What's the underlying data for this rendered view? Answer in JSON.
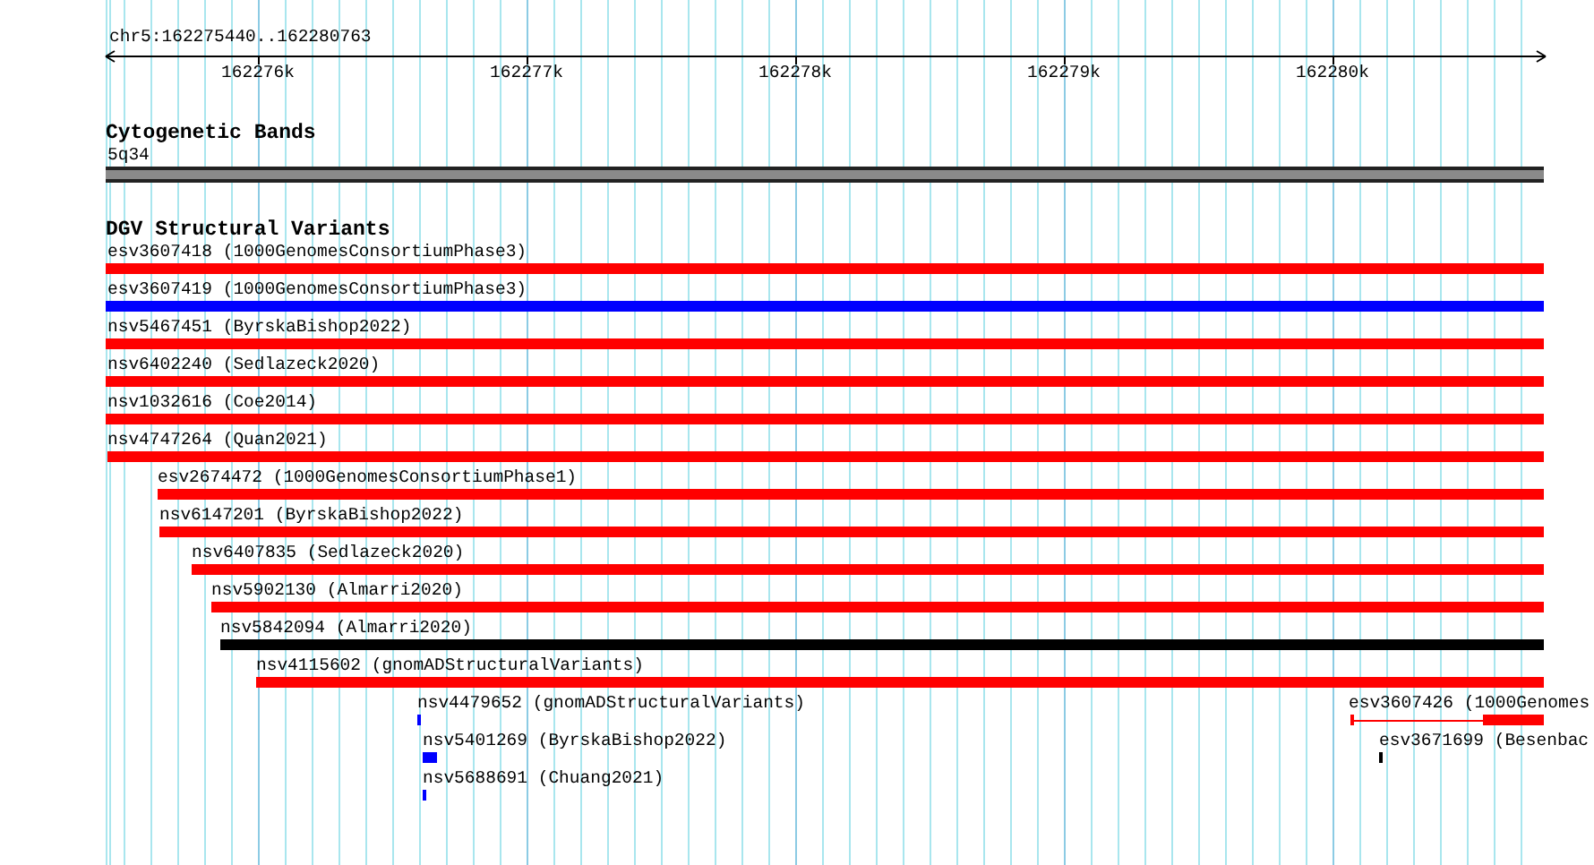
{
  "location": "chr5:162275440..162280763",
  "ruler": {
    "ticks": [
      "162276k",
      "162277k",
      "162278k",
      "162279k",
      "162280k"
    ]
  },
  "tracks": [
    {
      "title": "Cytogenetic Bands",
      "kind": "bands",
      "bands": [
        {
          "label": "5q34"
        }
      ]
    },
    {
      "title": "DGV Structural Variants",
      "kind": "features",
      "features": [
        {
          "label": "esv3607418 (1000GenomesConsortiumPhase3)",
          "color": "#ff0000",
          "kind": "bar"
        },
        {
          "label": "esv3607419 (1000GenomesConsortiumPhase3)",
          "color": "#0000ff",
          "kind": "bar"
        },
        {
          "label": "nsv5467451 (ByrskaBishop2022)",
          "color": "#ff0000",
          "kind": "bar"
        },
        {
          "label": "nsv6402240 (Sedlazeck2020)",
          "color": "#ff0000",
          "kind": "bar"
        },
        {
          "label": "nsv1032616 (Coe2014)",
          "color": "#ff0000",
          "kind": "bar"
        },
        {
          "label": "nsv4747264 (Quan2021)",
          "color": "#ff0000",
          "kind": "bar"
        },
        {
          "label": "esv2674472 (1000GenomesConsortiumPhase1)",
          "color": "#ff0000",
          "kind": "bar"
        },
        {
          "label": "nsv6147201 (ByrskaBishop2022)",
          "color": "#ff0000",
          "kind": "bar"
        },
        {
          "label": "nsv6407835 (Sedlazeck2020)",
          "color": "#ff0000",
          "kind": "bar"
        },
        {
          "label": "nsv5902130 (Almarri2020)",
          "color": "#ff0000",
          "kind": "bar"
        },
        {
          "label": "nsv5842094 (Almarri2020)",
          "color": "#000000",
          "kind": "bar"
        },
        {
          "label": "nsv4115602 (gnomADStructuralVariants)",
          "color": "#ff0000",
          "kind": "bar"
        },
        {
          "label": "nsv4479652 (gnomADStructuralVariants)",
          "color": "#0000ff",
          "kind": "bar"
        },
        {
          "label": "esv3607426 (1000Genomes",
          "color": "#ff0000",
          "kind": "split"
        },
        {
          "label": "nsv5401269 (ByrskaBishop2022)",
          "color": "#0000ff",
          "kind": "bar"
        },
        {
          "label": "esv3671699 (Besenbac",
          "color": "#000000",
          "kind": "bar"
        },
        {
          "label": "nsv5688691 (Chuang2021)",
          "color": "#0000ff",
          "kind": "bar"
        }
      ]
    }
  ]
}
